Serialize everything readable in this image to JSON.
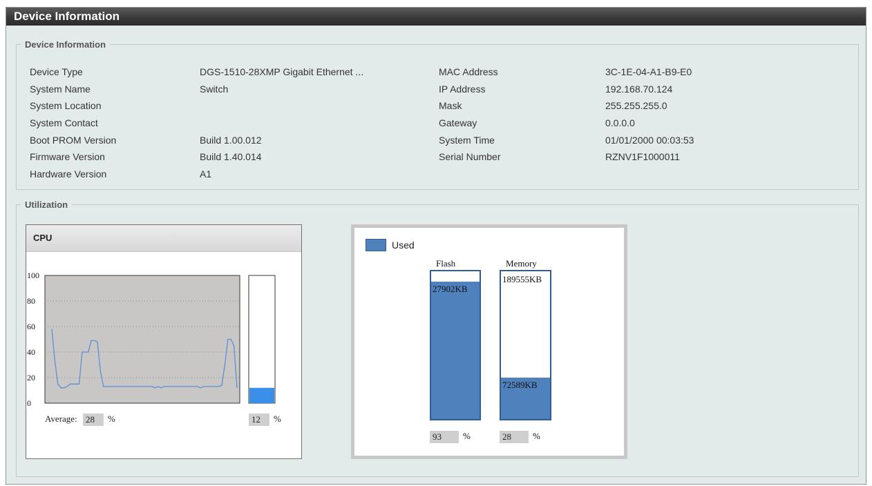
{
  "page": {
    "title": "Device Information"
  },
  "device_info": {
    "legend": "Device Information",
    "left": [
      {
        "label": "Device Type",
        "value": "DGS-1510-28XMP Gigabit Ethernet ..."
      },
      {
        "label": "System Name",
        "value": "Switch"
      },
      {
        "label": "System Location",
        "value": ""
      },
      {
        "label": "System Contact",
        "value": ""
      },
      {
        "label": "Boot PROM Version",
        "value": "Build 1.00.012"
      },
      {
        "label": "Firmware Version",
        "value": "Build 1.40.014"
      },
      {
        "label": "Hardware Version",
        "value": "A1"
      }
    ],
    "right": [
      {
        "label": "MAC Address",
        "value": "3C-1E-04-A1-B9-E0"
      },
      {
        "label": "IP Address",
        "value": "192.168.70.124"
      },
      {
        "label": "Mask",
        "value": "255.255.255.0"
      },
      {
        "label": "Gateway",
        "value": "0.0.0.0"
      },
      {
        "label": "System Time",
        "value": "01/01/2000 00:03:53"
      },
      {
        "label": "Serial Number",
        "value": "RZNV1F1000011"
      }
    ]
  },
  "utilization": {
    "legend": "Utilization",
    "cpu": {
      "title": "CPU",
      "average_label": "Average:",
      "average_value": "28",
      "current_value": "12",
      "unit": "%"
    },
    "storage": {
      "legend_label": "Used",
      "flash": {
        "title": "Flash",
        "used_label": "27902KB",
        "percent": "93",
        "unit": "%"
      },
      "memory": {
        "title": "Memory",
        "free_label": "189555KB",
        "used_label": "72589KB",
        "percent": "28",
        "unit": "%"
      }
    }
  },
  "colors": {
    "title_bar": "#3a3a3a",
    "panel_bg": "#e3ebea",
    "bar_fill": "#4f81bd",
    "cpu_line": "#5b8fd6",
    "cpu_bar": "#3b8fe8",
    "chart_bg": "#c9c6c6"
  },
  "chart_data": {
    "type": "line",
    "title": "CPU",
    "xlabel": "",
    "ylabel": "",
    "ylim": [
      0,
      100
    ],
    "yticks": [
      0,
      20,
      40,
      60,
      80,
      100
    ],
    "grid": true,
    "series": [
      {
        "values": [
          58,
          33,
          15,
          12,
          12,
          13,
          15,
          15,
          15,
          15,
          40,
          40,
          40,
          49,
          49,
          48,
          25,
          13,
          13,
          13,
          13,
          13,
          13,
          13,
          13,
          13,
          13,
          13,
          13,
          13,
          13,
          13,
          13,
          13,
          12,
          13,
          12,
          13,
          13,
          13,
          13,
          13,
          13,
          13,
          13,
          13,
          13,
          13,
          13,
          12,
          13,
          13,
          13,
          13,
          13,
          13,
          14,
          30,
          50,
          50,
          45,
          12
        ]
      }
    ],
    "current_bar": {
      "value": 12,
      "range": [
        0,
        100
      ]
    }
  }
}
